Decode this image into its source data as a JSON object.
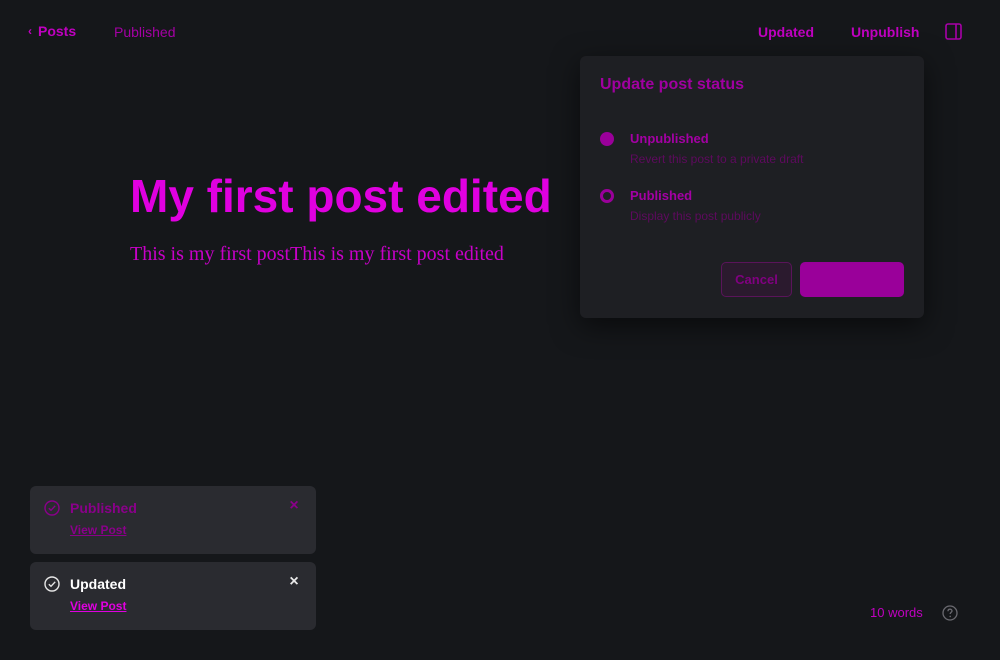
{
  "topbar": {
    "back_label": "Posts",
    "status": "Published",
    "updated_label": "Updated",
    "unpublish_label": "Unpublish"
  },
  "editor": {
    "title": "My first post edited",
    "body": "This is my first postThis is my first post edited"
  },
  "popover": {
    "title": "Update post status",
    "options": [
      {
        "label": "Unpublished",
        "description": "Revert this post to a private draft",
        "selected": true
      },
      {
        "label": "Published",
        "description": "Display this post publicly",
        "selected": false
      }
    ],
    "cancel_label": "Cancel",
    "confirm_label": ""
  },
  "toasts": [
    {
      "title": "Published",
      "link": "View Post"
    },
    {
      "title": "Updated",
      "link": "View Post"
    }
  ],
  "footer": {
    "word_count": "10 words"
  },
  "colors": {
    "accent": "#c000c0",
    "background": "#15171a",
    "popover": "#1e1f23",
    "toast": "#2a2b30"
  },
  "icons": {
    "back": "chevron-left-icon",
    "panel": "sidebar-toggle-icon",
    "toast": "check-circle-icon",
    "close": "close-icon",
    "help": "help-circle-icon"
  }
}
